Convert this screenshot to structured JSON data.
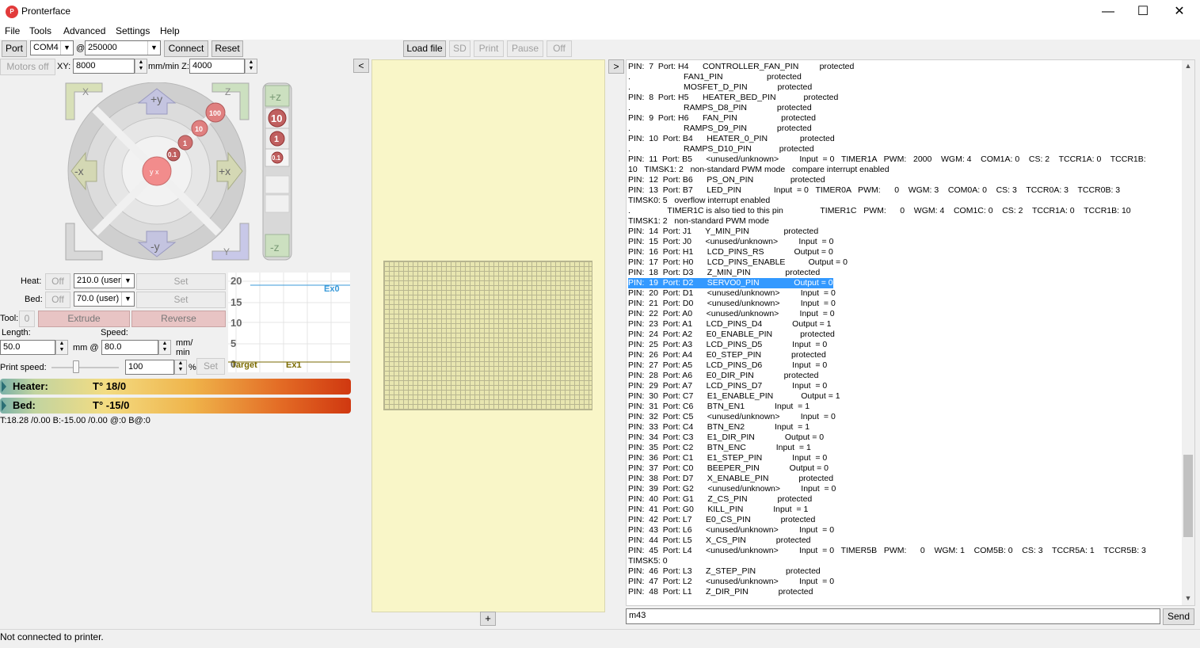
{
  "window": {
    "title": "Pronterface",
    "icon_text": "P",
    "minimize_glyph": "—",
    "maximize_glyph": "☐",
    "close_glyph": "✕"
  },
  "menu": [
    "File",
    "Tools",
    "Advanced",
    "Settings",
    "Help"
  ],
  "toolbar": {
    "port_label": "Port",
    "port_value": "COM4",
    "at_label": "@",
    "baud_value": "250000",
    "connect_label": "Connect",
    "reset_label": "Reset",
    "load_file_label": "Load file",
    "sd_label": "SD",
    "print_label": "Print",
    "pause_label": "Pause",
    "off_label": "Off"
  },
  "movement": {
    "motors_off_label": "Motors off",
    "xy_label": "XY:",
    "xy_value": "8000",
    "xy_unit_label": "mm/min Z:",
    "z_value": "4000"
  },
  "jog": {
    "plus_y": "+y",
    "minus_y": "-y",
    "plus_x": "+x",
    "minus_x": "-x",
    "home_x": "X",
    "home_z": "Z",
    "home_y": "Y",
    "step_100": "100",
    "step_10": "10",
    "step_1": "1",
    "step_01": "0.1",
    "center_label": "y x",
    "plus_z": "+z",
    "minus_z": "-z",
    "z_step_10": "10",
    "z_step_1": "1",
    "z_step_01": "0.1"
  },
  "temps": {
    "heat_label": "Heat:",
    "heat_off": "Off",
    "heat_value": "210.0 (user)",
    "heat_set": "Set",
    "bed_label": "Bed:",
    "bed_off": "Off",
    "bed_value": "70.0 (user)",
    "bed_set": "Set",
    "tool_label": "Tool:",
    "tool_value": "0",
    "extrude_label": "Extrude",
    "reverse_label": "Reverse",
    "length_label": "Length:",
    "length_value": "50.0",
    "mm_at_label": "mm @",
    "speed_label": "Speed:",
    "speed_value": "80.0",
    "mmmin_label": "mm/\nmin",
    "print_speed_label": "Print speed:",
    "print_speed_value": "100",
    "percent_label": "%",
    "print_speed_set": "Set"
  },
  "graph": {
    "y_ticks": [
      "20",
      "15",
      "10",
      "5",
      "0"
    ],
    "ex0_label": "Ex0",
    "target_label": "Target",
    "ex1_label": "Ex1",
    "colors": {
      "ex0": "#3a9ad9",
      "target": "#7a6a00",
      "ex1": "#2a6e2a"
    }
  },
  "bars": {
    "heater_label": "Heater:",
    "heater_value": "T° 18/0",
    "bed_label": "Bed:",
    "bed_value": "T° -15/0"
  },
  "temp_report": "T:18.28 /0.00 B:-15.00 /0.00 @:0 B@:0",
  "viewer": {
    "collapse_left": "<",
    "collapse_right": ">",
    "add_button": "+"
  },
  "console": {
    "selected_index": 21,
    "lines": [
      "PIN:  7  Port: H4      CONTROLLER_FAN_PIN         protected",
      ".                       FAN1_PIN                   protected",
      ".                       MOSFET_D_PIN             protected",
      "PIN:  8  Port: H5      HEATER_BED_PIN            protected",
      ".                       RAMPS_D8_PIN             protected",
      "PIN:  9  Port: H6      FAN_PIN                   protected",
      ".                       RAMPS_D9_PIN             protected",
      "PIN:  10  Port: B4      HEATER_0_PIN              protected",
      ".                       RAMPS_D10_PIN            protected",
      "PIN:  11  Port: B5      <unused/unknown>         Input  = 0   TIMER1A   PWM:   2000    WGM: 4    COM1A: 0    CS: 2    TCCR1A: 0    TCCR1B:",
      "10   TIMSK1: 2   non-standard PWM mode   compare interrupt enabled",
      "PIN:  12  Port: B6      PS_ON_PIN                protected",
      "PIN:  13  Port: B7      LED_PIN              Input  = 0   TIMER0A   PWM:      0    WGM: 3    COM0A: 0    CS: 3    TCCR0A: 3    TCCR0B: 3",
      "TIMSK0: 5   overflow interrupt enabled",
      ".                TIMER1C is also tied to this pin                TIMER1C   PWM:      0    WGM: 4    COM1C: 0    CS: 2    TCCR1A: 0    TCCR1B: 10",
      "TIMSK1: 2   non-standard PWM mode",
      "PIN:  14  Port: J1      Y_MIN_PIN               protected",
      "PIN:  15  Port: J0      <unused/unknown>         Input  = 0",
      "PIN:  16  Port: H1      LCD_PINS_RS             Output = 0",
      "PIN:  17  Port: H0      LCD_PINS_ENABLE          Output = 0",
      "PIN:  18  Port: D3      Z_MIN_PIN               protected",
      "PIN:  19  Port: D2      SERVO0_PIN               Output = 0",
      "PIN:  20  Port: D1      <unused/unknown>         Input  = 0",
      "PIN:  21  Port: D0      <unused/unknown>         Input  = 0",
      "PIN:  22  Port: A0      <unused/unknown>         Input  = 0",
      "PIN:  23  Port: A1      LCD_PINS_D4             Output = 1",
      "PIN:  24  Port: A2      E0_ENABLE_PIN            protected",
      "PIN:  25  Port: A3      LCD_PINS_D5             Input  = 0",
      "PIN:  26  Port: A4      E0_STEP_PIN             protected",
      "PIN:  27  Port: A5      LCD_PINS_D6             Input  = 0",
      "PIN:  28  Port: A6      E0_DIR_PIN             protected",
      "PIN:  29  Port: A7      LCD_PINS_D7             Input  = 0",
      "PIN:  30  Port: C7      E1_ENABLE_PIN            Output = 1",
      "PIN:  31  Port: C6      BTN_EN1             Input  = 1",
      "PIN:  32  Port: C5      <unused/unknown>         Input  = 0",
      "PIN:  33  Port: C4      BTN_EN2             Input  = 1",
      "PIN:  34  Port: C3      E1_DIR_PIN             Output = 0",
      "PIN:  35  Port: C2      BTN_ENC             Input  = 1",
      "PIN:  36  Port: C1      E1_STEP_PIN             Input  = 0",
      "PIN:  37  Port: C0      BEEPER_PIN             Output = 0",
      "PIN:  38  Port: D7      X_ENABLE_PIN             protected",
      "PIN:  39  Port: G2      <unused/unknown>         Input  = 0",
      "PIN:  40  Port: G1      Z_CS_PIN             protected",
      "PIN:  41  Port: G0      KILL_PIN             Input  = 1",
      "PIN:  42  Port: L7      E0_CS_PIN             protected",
      "PIN:  43  Port: L6      <unused/unknown>         Input  = 0",
      "PIN:  44  Port: L5      X_CS_PIN             protected",
      "PIN:  45  Port: L4      <unused/unknown>         Input  = 0   TIMER5B   PWM:      0    WGM: 1    COM5B: 0    CS: 3    TCCR5A: 1    TCCR5B: 3",
      "TIMSK5: 0",
      "PIN:  46  Port: L3      Z_STEP_PIN             protected",
      "PIN:  47  Port: L2      <unused/unknown>         Input  = 0",
      "PIN:  48  Port: L1      Z_DIR_PIN             protected"
    ],
    "input_value": "m43",
    "send_label": "Send"
  },
  "status": "Not connected to printer."
}
